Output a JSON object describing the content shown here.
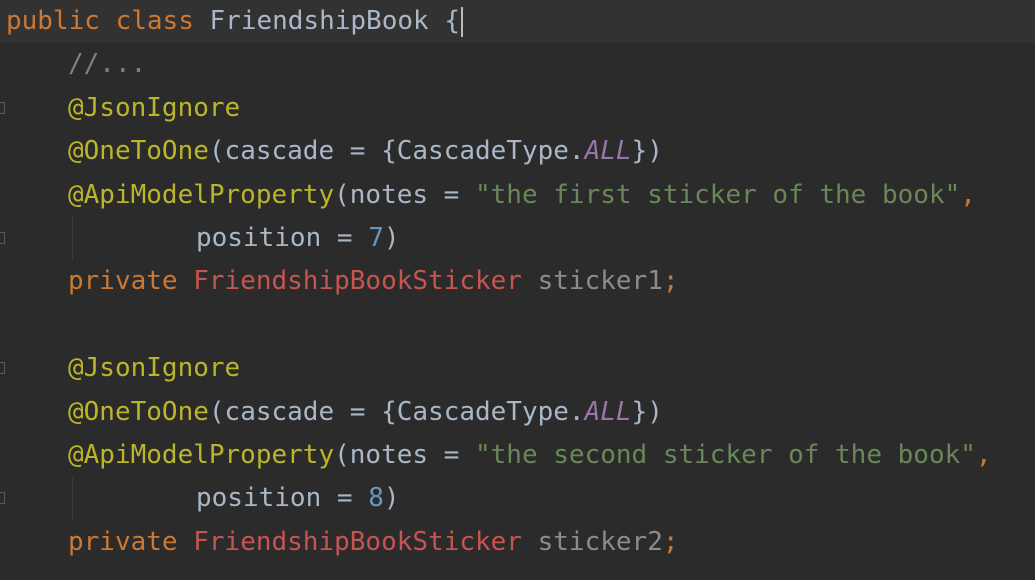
{
  "editor": {
    "language": "Java",
    "lines": [
      {
        "tokens": [
          {
            "t": "public",
            "c": "kw"
          },
          {
            "t": " ",
            "c": "plain"
          },
          {
            "t": "class",
            "c": "kw"
          },
          {
            "t": " ",
            "c": "plain"
          },
          {
            "t": "FriendshipBook",
            "c": "cls"
          },
          {
            "t": " {",
            "c": "plain"
          }
        ],
        "indent": 0,
        "current": true,
        "caret": true
      },
      {
        "tokens": [
          {
            "t": "//...",
            "c": "cmt"
          }
        ],
        "indent": 1
      },
      {
        "tokens": [
          {
            "t": "@JsonIgnore",
            "c": "ann"
          }
        ],
        "indent": 1,
        "fold": true
      },
      {
        "tokens": [
          {
            "t": "@OneToOne",
            "c": "ann"
          },
          {
            "t": "(cascade = {CascadeType.",
            "c": "plain"
          },
          {
            "t": "ALL",
            "c": "const"
          },
          {
            "t": "})",
            "c": "plain"
          }
        ],
        "indent": 1
      },
      {
        "tokens": [
          {
            "t": "@ApiModelProperty",
            "c": "ann"
          },
          {
            "t": "(notes = ",
            "c": "plain"
          },
          {
            "t": "\"the first sticker of the book\"",
            "c": "str"
          },
          {
            "t": ",",
            "c": "semi"
          }
        ],
        "indent": 1
      },
      {
        "tokens": [
          {
            "t": "position = ",
            "c": "plain"
          },
          {
            "t": "7",
            "c": "num"
          },
          {
            "t": ")",
            "c": "plain"
          }
        ],
        "indent": 2,
        "fold": true,
        "guide": true
      },
      {
        "tokens": [
          {
            "t": "private",
            "c": "kw"
          },
          {
            "t": " ",
            "c": "plain"
          },
          {
            "t": "FriendshipBookSticker",
            "c": "type-red"
          },
          {
            "t": " ",
            "c": "plain"
          },
          {
            "t": "sticker1",
            "c": "unused"
          },
          {
            "t": ";",
            "c": "semi"
          }
        ],
        "indent": 1
      },
      {
        "tokens": [],
        "indent": 0
      },
      {
        "tokens": [
          {
            "t": "@JsonIgnore",
            "c": "ann"
          }
        ],
        "indent": 1,
        "fold": true
      },
      {
        "tokens": [
          {
            "t": "@OneToOne",
            "c": "ann"
          },
          {
            "t": "(cascade = {CascadeType.",
            "c": "plain"
          },
          {
            "t": "ALL",
            "c": "const"
          },
          {
            "t": "})",
            "c": "plain"
          }
        ],
        "indent": 1
      },
      {
        "tokens": [
          {
            "t": "@ApiModelProperty",
            "c": "ann"
          },
          {
            "t": "(notes = ",
            "c": "plain"
          },
          {
            "t": "\"the second sticker of the book\"",
            "c": "str"
          },
          {
            "t": ",",
            "c": "semi"
          }
        ],
        "indent": 1
      },
      {
        "tokens": [
          {
            "t": "position = ",
            "c": "plain"
          },
          {
            "t": "8",
            "c": "num"
          },
          {
            "t": ")",
            "c": "plain"
          }
        ],
        "indent": 2,
        "fold": true,
        "guide": true
      },
      {
        "tokens": [
          {
            "t": "private",
            "c": "kw"
          },
          {
            "t": " ",
            "c": "plain"
          },
          {
            "t": "FriendshipBookSticker",
            "c": "type-red"
          },
          {
            "t": " ",
            "c": "plain"
          },
          {
            "t": "sticker2",
            "c": "unused"
          },
          {
            "t": ";",
            "c": "semi"
          }
        ],
        "indent": 1
      }
    ]
  },
  "colors": {
    "background": "#2b2b2b",
    "current_line": "#323232",
    "keyword": "#cc7832",
    "annotation": "#bbb529",
    "string": "#6a8759",
    "number": "#6897bb",
    "comment": "#808080",
    "constant": "#9876aa",
    "error_type": "#c75450",
    "unused_field": "#8c8c8c",
    "plain": "#a9b7c6"
  }
}
